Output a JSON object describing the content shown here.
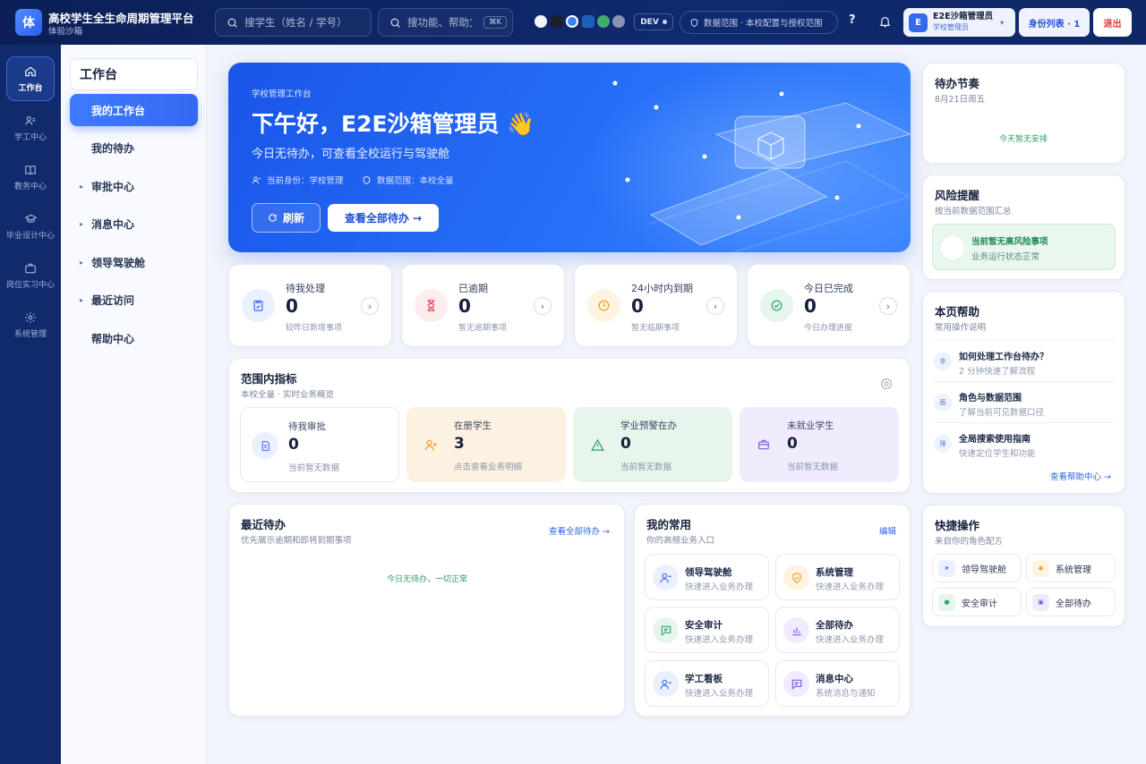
{
  "app": {
    "logo_char": "体",
    "title": "高校学生全生命周期管理平台",
    "subtitle": "体验沙箱"
  },
  "header": {
    "student_search_placeholder": "搜学生（姓名 / 学号）",
    "func_search_placeholder": "搜功能、帮助文档",
    "shortcut": "⌘K",
    "env_badge": "DEV",
    "scope_label": "数据范围 · 本校配置与授权范围",
    "help_label": "?",
    "user": {
      "avatar": "E",
      "name": "E2E沙箱管理员",
      "role": "学校管理员"
    },
    "role_list_label": "身份列表 · 1",
    "logout_label": "退出",
    "theme_colors": [
      "#f3f5fb",
      "#1b1f2e",
      "#3b82f6",
      "#1e5fb8",
      "#3fae6a",
      "#8a93b5"
    ]
  },
  "rail": [
    {
      "label": "工作台",
      "icon": "home-icon"
    },
    {
      "label": "学工中心",
      "icon": "users-icon"
    },
    {
      "label": "教务中心",
      "icon": "book-icon"
    },
    {
      "label": "毕业设计中心",
      "icon": "graduation-cap-icon"
    },
    {
      "label": "岗位实习中心",
      "icon": "briefcase-icon"
    },
    {
      "label": "系统管理",
      "icon": "gear-icon"
    }
  ],
  "subnav": {
    "title": "工作台",
    "items": [
      {
        "label": "我的工作台",
        "arrow": ""
      },
      {
        "label": "我的待办",
        "arrow": ""
      },
      {
        "label": "审批中心",
        "arrow": "▸"
      },
      {
        "label": "消息中心",
        "arrow": "▸"
      },
      {
        "label": "领导驾驶舱",
        "arrow": "▸"
      },
      {
        "label": "最近访问",
        "arrow": "▸"
      },
      {
        "label": "帮助中心",
        "arrow": ""
      }
    ]
  },
  "hero": {
    "eyebrow": "学校管理工作台",
    "greeting": "下午好，E2E沙箱管理员 👋",
    "summary": "今日无待办，可查看全校运行与驾驶舱",
    "identity": "当前身份：学校管理",
    "scope": "数据范围：本校全量",
    "refresh_label": "刷新",
    "view_all_label": "查看全部待办 →"
  },
  "stats": [
    {
      "label": "待我处理",
      "value": "0",
      "hint": "较昨日新增事项",
      "color": "#3b6ff0",
      "bg": "#e9f0ff",
      "icon": "clipboard-icon"
    },
    {
      "label": "已逾期",
      "value": "0",
      "hint": "暂无逾期事项",
      "color": "#e5484d",
      "bg": "#fdecef",
      "icon": "hourglass-icon"
    },
    {
      "label": "24小时内到期",
      "value": "0",
      "hint": "暂无临期事项",
      "color": "#f0a020",
      "bg": "#fff3e2",
      "icon": "clock-icon"
    },
    {
      "label": "今日已完成",
      "value": "0",
      "hint": "今日办理进度",
      "color": "#2fa86a",
      "bg": "#e6f6ed",
      "icon": "check-circle-icon"
    }
  ],
  "metrics_card": {
    "title": "范围内指标",
    "subtitle": "本校全量 · 实时业务概览",
    "items": [
      {
        "label": "待我审批",
        "value": "0",
        "hint": "当前暂无数据",
        "bg": "#ffffff",
        "icon_bg": "#eaf0ff",
        "color": "#3b6ff0",
        "icon": "document-icon"
      },
      {
        "label": "在册学生",
        "value": "3",
        "hint": "点击查看业务明细",
        "bg": "#fdf1e2",
        "icon_bg": "#fdf1e2",
        "color": "#f0a020",
        "icon": "user-plus-icon"
      },
      {
        "label": "学业预警在办",
        "value": "0",
        "hint": "当前暂无数据",
        "bg": "#e7f5ec",
        "icon_bg": "#e7f5ec",
        "color": "#2f9a62",
        "icon": "warning-icon"
      },
      {
        "label": "未就业学生",
        "value": "0",
        "hint": "当前暂无数据",
        "bg": "#f0ecfd",
        "icon_bg": "#f0ecfd",
        "color": "#7d5ae0",
        "icon": "briefcase-icon"
      }
    ]
  },
  "recent_todo": {
    "title": "最近待办",
    "subtitle": "优先展示逾期和即将到期事项",
    "link": "查看全部待办 →",
    "empty": "今日无待办，一切正常"
  },
  "favorites": {
    "title": "我的常用",
    "subtitle": "你的高频业务入口",
    "edit_label": "编辑",
    "items": [
      {
        "title": "领导驾驶舱",
        "desc": "快速进入业务办理",
        "color": "#3b6ff0",
        "bg": "#eaf0ff",
        "icon": "user-icon"
      },
      {
        "title": "系统管理",
        "desc": "快速进入业务办理",
        "color": "#f0a020",
        "bg": "#fff3e2",
        "icon": "shield-icon"
      },
      {
        "title": "安全审计",
        "desc": "快速进入业务办理",
        "color": "#2fa86a",
        "bg": "#e6f6ed",
        "icon": "chat-icon"
      },
      {
        "title": "全部待办",
        "desc": "快速进入业务办理",
        "color": "#7d5ae0",
        "bg": "#f0ecfd",
        "icon": "chart-icon"
      },
      {
        "title": "学工看板",
        "desc": "快速进入业务办理",
        "color": "#3b6ff0",
        "bg": "#eaf0ff",
        "icon": "user-icon"
      },
      {
        "title": "消息中心",
        "desc": "系统消息与通知",
        "color": "#7d5ae0",
        "bg": "#f0ecfd",
        "icon": "chat-icon"
      }
    ]
  },
  "schedule": {
    "title": "待办节奏",
    "date": "8月21日周五",
    "empty": "今天暂无安排"
  },
  "risk": {
    "title": "风险提醒",
    "subtitle": "按当前数据范围汇总",
    "status_title": "当前暂无高风险事项",
    "status_desc": "业务运行状态正常"
  },
  "help": {
    "title": "本页帮助",
    "subtitle": "常用操作说明",
    "items": [
      {
        "mark": "非",
        "title": "如何处理工作台待办？",
        "desc": "2 分钟快速了解流程"
      },
      {
        "mark": "面",
        "title": "角色与数据范围",
        "desc": "了解当前可见数据口径"
      },
      {
        "mark": "搜",
        "title": "全局搜索使用指南",
        "desc": "快速定位学生和功能"
      }
    ],
    "link": "查看帮助中心 →"
  },
  "quick": {
    "title": "快捷操作",
    "subtitle": "来自你的角色配方",
    "items": [
      {
        "label": "领导驾驶舱",
        "mark": "➤",
        "color": "#3b6ff0",
        "bg": "#eaf0ff"
      },
      {
        "label": "系统管理",
        "mark": "◆",
        "color": "#f0a020",
        "bg": "#fff3e2"
      },
      {
        "label": "安全审计",
        "mark": "●",
        "color": "#2fa86a",
        "bg": "#e6f6ed"
      },
      {
        "label": "全部待办",
        "mark": "▣",
        "color": "#7d5ae0",
        "bg": "#f0ecfd"
      }
    ]
  }
}
